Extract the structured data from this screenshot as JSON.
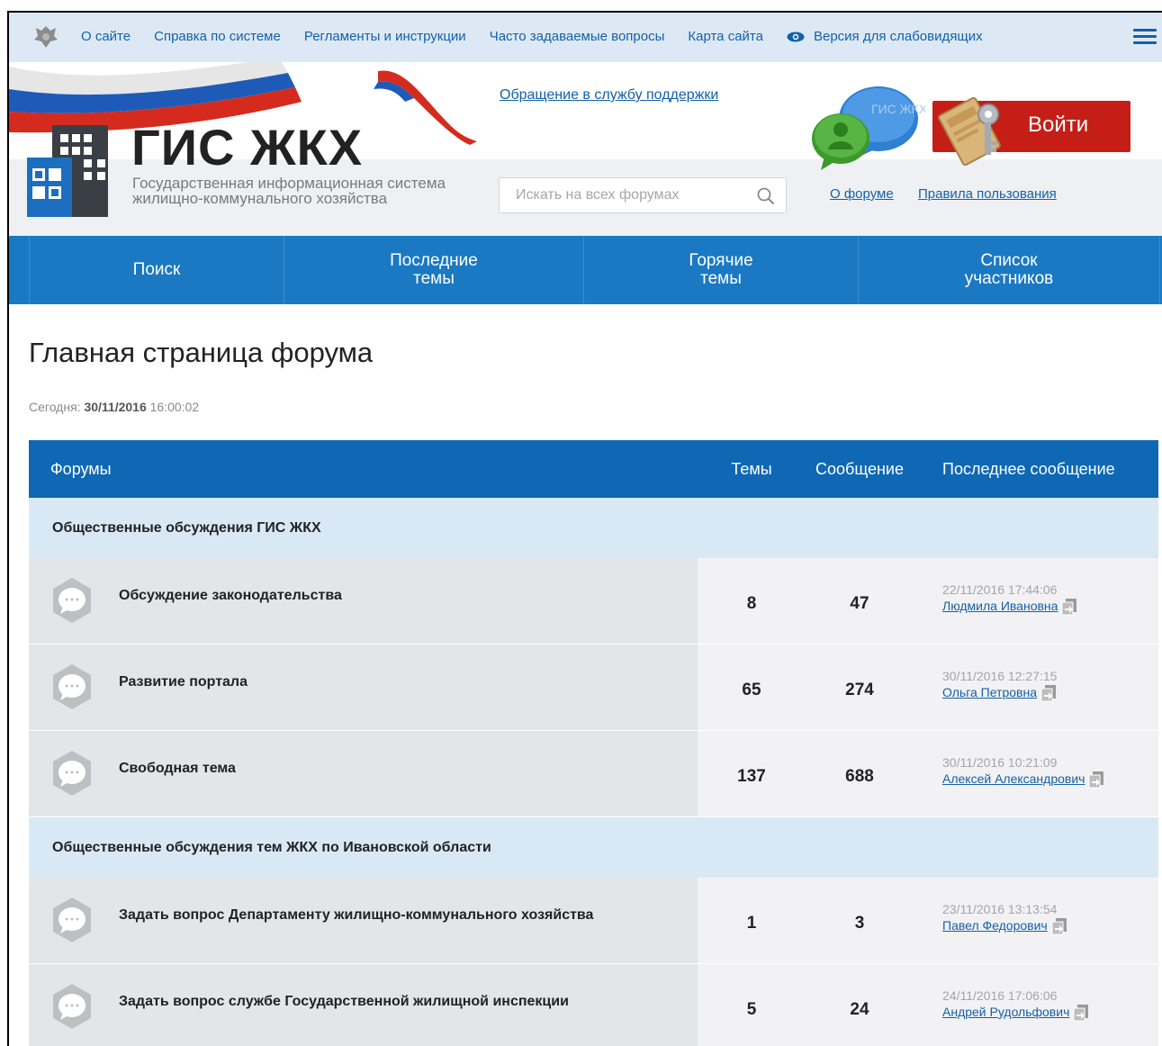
{
  "topbar": {
    "links": [
      "О сайте",
      "Справка по системе",
      "Регламенты и инструкции",
      "Часто задаваемые вопросы",
      "Карта сайта"
    ],
    "accessibility": "Версия для слабовидящих"
  },
  "header": {
    "logo_title": "ГИС ЖКХ",
    "logo_sub_1": "Государственная информационная система",
    "logo_sub_2": "жилищно-коммунального хозяйства",
    "support_link": "Обращение в службу поддержки",
    "search_placeholder": "Искать на всех форумах",
    "about_link": "О форуме",
    "rules_link": "Правила пользования",
    "login_label": "Войти",
    "chat_icon_text": "ГИС ЖКХ"
  },
  "nav": {
    "items": [
      "Поиск",
      "Последние темы",
      "Горячие темы",
      "Список участников"
    ]
  },
  "main": {
    "title": "Главная страница форума",
    "today_label": "Сегодня:",
    "today_date": "30/11/2016",
    "today_time": "16:00:02"
  },
  "table": {
    "headers": {
      "forums": "Форумы",
      "topics": "Темы",
      "messages": "Сообщение",
      "last": "Последнее сообщение"
    },
    "sections": [
      {
        "title": "Общественные обсуждения ГИС ЖКХ",
        "rows": [
          {
            "name": "Обсуждение законодательства",
            "topics": "8",
            "messages": "47",
            "last_date": "22/11/2016 17:44:06",
            "last_user": "Людмила Ивановна"
          },
          {
            "name": "Развитие портала",
            "topics": "65",
            "messages": "274",
            "last_date": "30/11/2016 12:27:15",
            "last_user": "Ольга Петровна"
          },
          {
            "name": "Свободная тема",
            "topics": "137",
            "messages": "688",
            "last_date": "30/11/2016 10:21:09",
            "last_user": "Алексей Александрович"
          }
        ]
      },
      {
        "title": "Общественные обсуждения тем ЖКХ по Ивановской области",
        "rows": [
          {
            "name": "Задать вопрос Департаменту жилищно-коммунального хозяйства",
            "topics": "1",
            "messages": "3",
            "last_date": "23/11/2016 13:13:54",
            "last_user": "Павел Федорович"
          },
          {
            "name": "Задать вопрос службе Государственной жилищной инспекции",
            "topics": "5",
            "messages": "24",
            "last_date": "24/11/2016 17:06:06",
            "last_user": "Андрей Рудольфович"
          }
        ]
      }
    ]
  },
  "colors": {
    "brand_blue": "#1a79c2",
    "table_header": "#0f68b3",
    "link": "#1460aa",
    "login_red": "#c41e17"
  }
}
